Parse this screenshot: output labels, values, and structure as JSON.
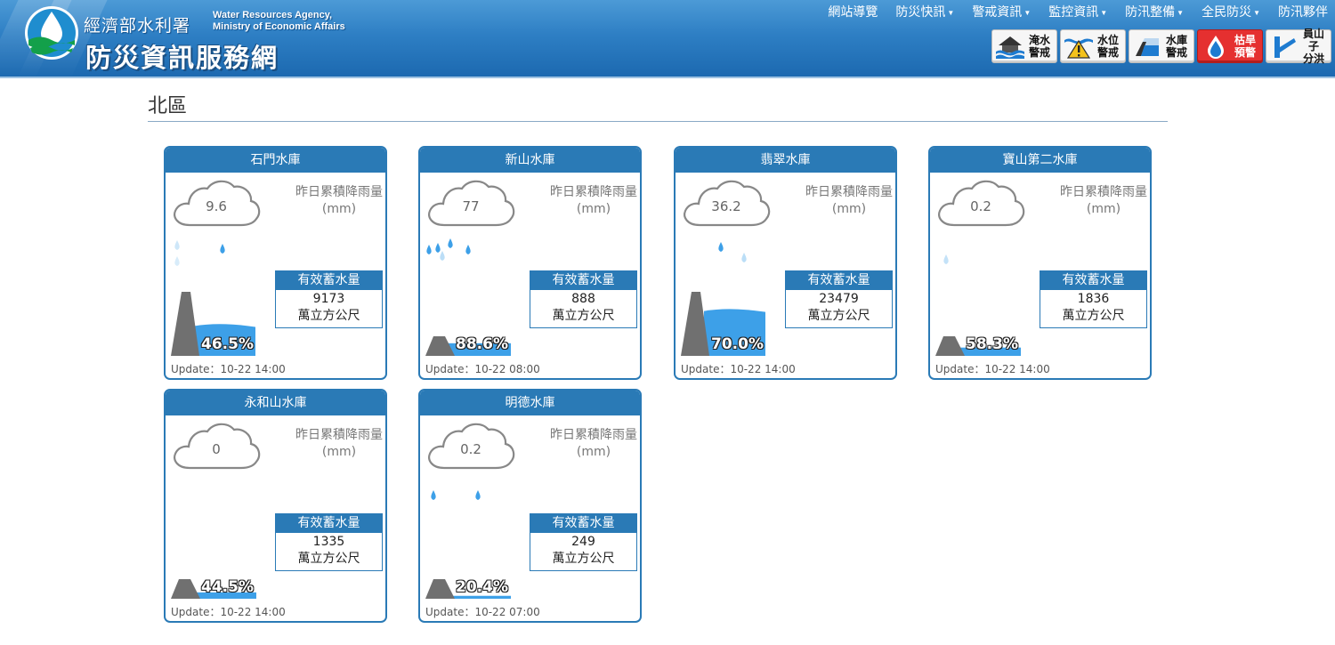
{
  "header": {
    "agency_cn": "經濟部水利署",
    "agency_en_line1": "Water Resources Agency,",
    "agency_en_line2": "Ministry of Economic Affairs",
    "site_title": "防災資訊服務網",
    "nav": [
      {
        "label": "網站導覽",
        "dropdown": false
      },
      {
        "label": "防災快訊",
        "dropdown": true
      },
      {
        "label": "警戒資訊",
        "dropdown": true
      },
      {
        "label": "監控資訊",
        "dropdown": true
      },
      {
        "label": "防汛整備",
        "dropdown": true
      },
      {
        "label": "全民防災",
        "dropdown": true
      },
      {
        "label": "防汛夥伴",
        "dropdown": false
      }
    ],
    "alert_buttons": [
      {
        "line1": "淹水",
        "line2": "警戒",
        "icon": "flood-house-icon"
      },
      {
        "line1": "水位",
        "line2": "警戒",
        "icon": "water-level-warning-icon"
      },
      {
        "line1": "水庫",
        "line2": "警戒",
        "icon": "reservoir-icon"
      },
      {
        "line1": "枯旱",
        "line2": "預警",
        "icon": "water-drop-icon"
      },
      {
        "line1": "員山子",
        "line2": "分洪",
        "icon": "diversion-icon"
      }
    ]
  },
  "region": {
    "title": "北區"
  },
  "labels": {
    "rain_label": "昨日累積降雨量",
    "rain_unit": "(mm)",
    "storage_label": "有效蓄水量",
    "storage_unit": "萬立方公尺",
    "update_prefix": "Update："
  },
  "reservoirs": [
    {
      "name": "石門水庫",
      "rain": "9.6",
      "storage": "9173",
      "percent": "46.5%",
      "fill": 0.465,
      "update": "10-22 14:00"
    },
    {
      "name": "新山水庫",
      "rain": "77",
      "storage": "888",
      "percent": "88.6%",
      "fill": 0.886,
      "update": "10-22 08:00"
    },
    {
      "name": "翡翠水庫",
      "rain": "36.2",
      "storage": "23479",
      "percent": "70.0%",
      "fill": 0.7,
      "update": "10-22 14:00"
    },
    {
      "name": "寶山第二水庫",
      "rain": "0.2",
      "storage": "1836",
      "percent": "58.3%",
      "fill": 0.583,
      "update": "10-22 14:00"
    },
    {
      "name": "永和山水庫",
      "rain": "0",
      "storage": "1335",
      "percent": "44.5%",
      "fill": 0.445,
      "update": "10-22 14:00"
    },
    {
      "name": "明德水庫",
      "rain": "0.2",
      "storage": "249",
      "percent": "20.4%",
      "fill": 0.204,
      "update": "10-22 07:00"
    }
  ],
  "colors": {
    "primary": "#2a7ab6",
    "water": "#3da0e8",
    "dam": "#707070"
  }
}
